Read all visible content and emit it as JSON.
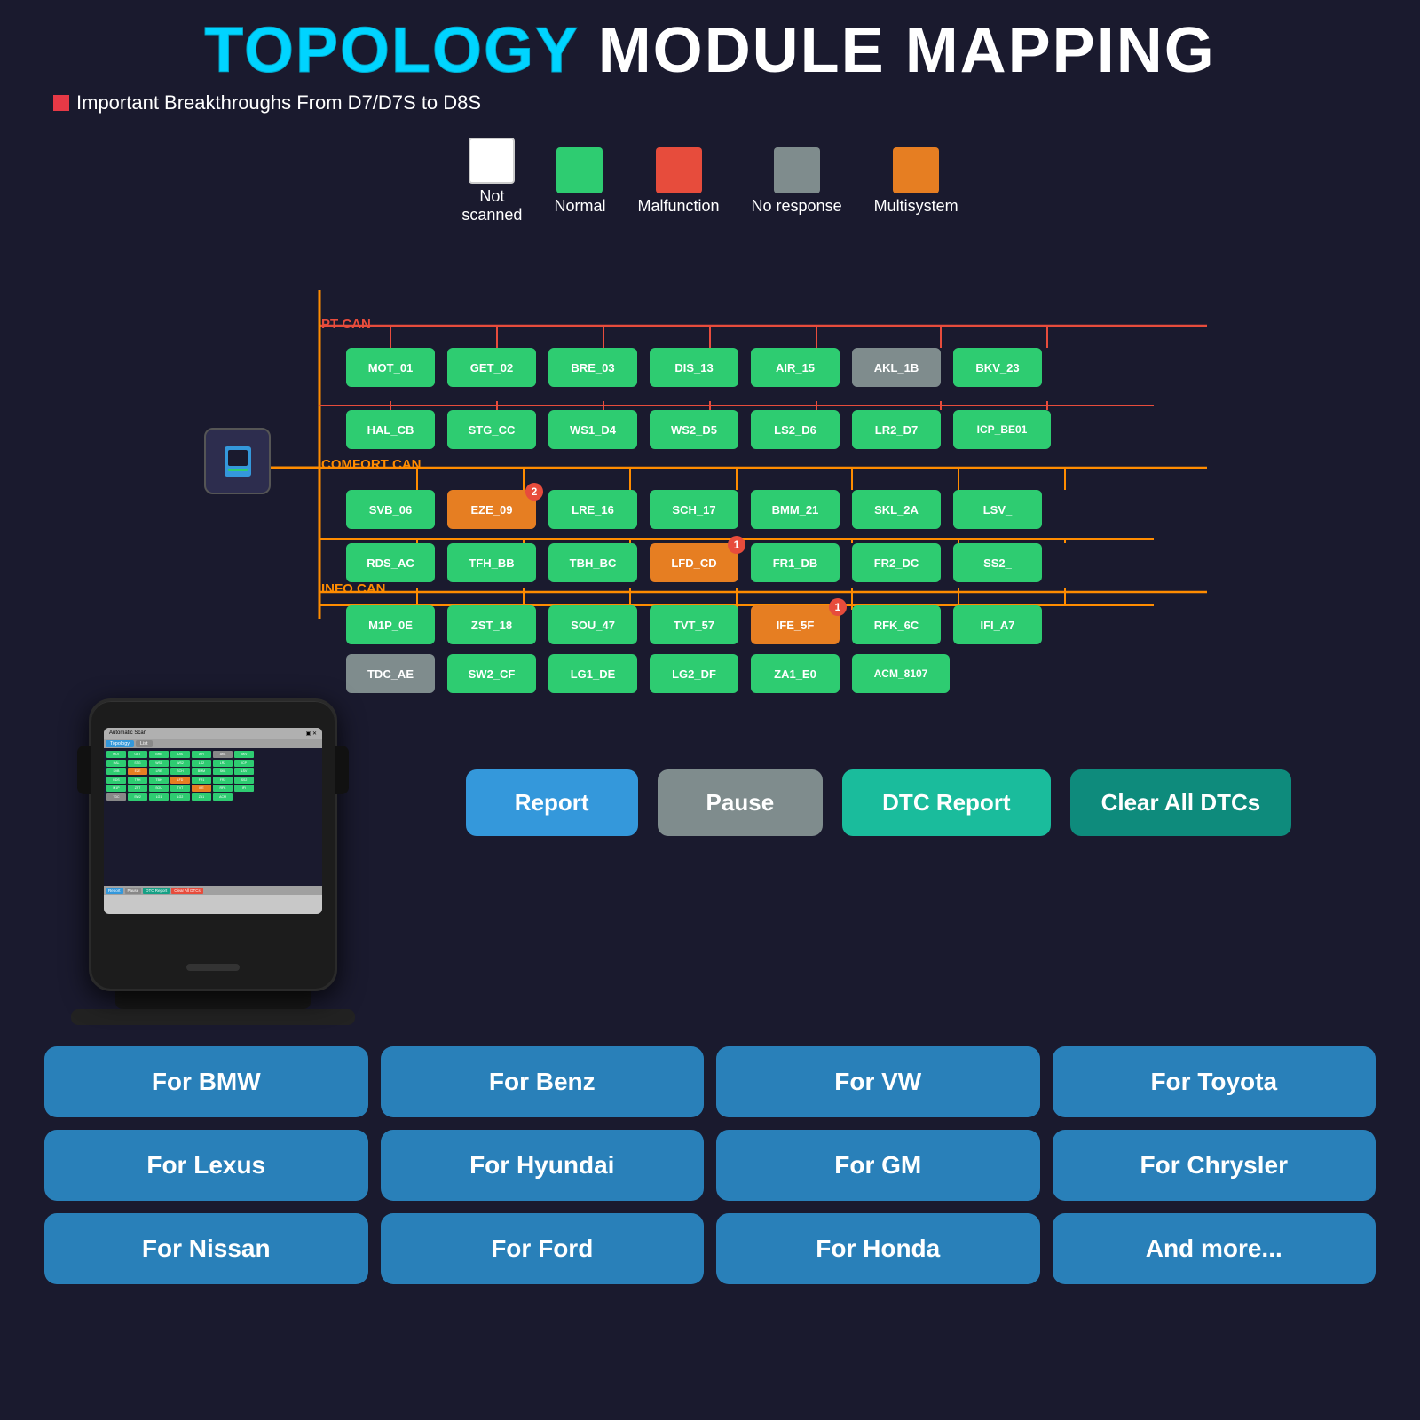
{
  "header": {
    "title_cyan": "TOPOLOGY",
    "title_white": " MODULE MAPPING",
    "subtitle": "Important Breakthroughs From D7/D7S to D8S"
  },
  "legend": [
    {
      "id": "not-scanned",
      "color": "#ffffff",
      "border": "#cccccc",
      "label": "Not\nscanned"
    },
    {
      "id": "normal",
      "color": "#2ecc71",
      "border": "none",
      "label": "Normal"
    },
    {
      "id": "malfunction",
      "color": "#e74c3c",
      "border": "none",
      "label": "Malfunction"
    },
    {
      "id": "no-response",
      "color": "#7f8c8d",
      "border": "none",
      "label": "No response"
    },
    {
      "id": "multisystem",
      "color": "#e67e22",
      "border": "none",
      "label": "Multisystem"
    }
  ],
  "topology": {
    "scan_device_icon": "📋",
    "buses": [
      {
        "id": "pt-can",
        "label": "PT CAN"
      },
      {
        "id": "comfort-can",
        "label": "COMFORT CAN"
      },
      {
        "id": "info-can",
        "label": "INFO CAN"
      }
    ],
    "nodes": [
      {
        "id": "MOT_01",
        "label": "MOT_01",
        "color": "green",
        "row": 0,
        "col": 0
      },
      {
        "id": "GET_02",
        "label": "GET_02",
        "color": "green",
        "row": 0,
        "col": 1
      },
      {
        "id": "BRE_03",
        "label": "BRE_03",
        "color": "green",
        "row": 0,
        "col": 2
      },
      {
        "id": "DIS_13",
        "label": "DIS_13",
        "color": "green",
        "row": 0,
        "col": 3
      },
      {
        "id": "AIR_15",
        "label": "AIR_15",
        "color": "green",
        "row": 0,
        "col": 4
      },
      {
        "id": "AKL_1B",
        "label": "AKL_1B",
        "color": "gray",
        "row": 0,
        "col": 5
      },
      {
        "id": "BKV_23",
        "label": "BKV_23",
        "color": "green",
        "row": 0,
        "col": 6
      },
      {
        "id": "HAL_CB",
        "label": "HAL_CB",
        "color": "green",
        "row": 1,
        "col": 0
      },
      {
        "id": "STG_CC",
        "label": "STG_CC",
        "color": "green",
        "row": 1,
        "col": 1
      },
      {
        "id": "WS1_D4",
        "label": "WS1_D4",
        "color": "green",
        "row": 1,
        "col": 2
      },
      {
        "id": "WS2_D5",
        "label": "WS2_D5",
        "color": "green",
        "row": 1,
        "col": 3
      },
      {
        "id": "LS2_D6",
        "label": "LS2_D6",
        "color": "green",
        "row": 1,
        "col": 4
      },
      {
        "id": "LR2_D7",
        "label": "LR2_D7",
        "color": "green",
        "row": 1,
        "col": 5
      },
      {
        "id": "ICP_BE01",
        "label": "ICP_BE01",
        "color": "green",
        "row": 1,
        "col": 6
      },
      {
        "id": "SVB_06",
        "label": "SVB_06",
        "color": "green",
        "row": 2,
        "col": 0
      },
      {
        "id": "EZE_09",
        "label": "EZE_09",
        "color": "orange",
        "row": 2,
        "col": 1,
        "badge": "2"
      },
      {
        "id": "LRE_16",
        "label": "LRE_16",
        "color": "green",
        "row": 2,
        "col": 2
      },
      {
        "id": "SCH_17",
        "label": "SCH_17",
        "color": "green",
        "row": 2,
        "col": 3
      },
      {
        "id": "BMM_21",
        "label": "BMM_21",
        "color": "green",
        "row": 2,
        "col": 4
      },
      {
        "id": "SKL_2A",
        "label": "SKL_2A",
        "color": "green",
        "row": 2,
        "col": 5
      },
      {
        "id": "LSV_",
        "label": "LSV_",
        "color": "green",
        "row": 2,
        "col": 6
      },
      {
        "id": "RDS_AC",
        "label": "RDS_AC",
        "color": "green",
        "row": 3,
        "col": 0
      },
      {
        "id": "TFH_BB",
        "label": "TFH_BB",
        "color": "green",
        "row": 3,
        "col": 1
      },
      {
        "id": "TBH_BC",
        "label": "TBH_BC",
        "color": "green",
        "row": 3,
        "col": 2
      },
      {
        "id": "LFD_CD",
        "label": "LFD_CD",
        "color": "orange",
        "row": 3,
        "col": 3,
        "badge": "1"
      },
      {
        "id": "FR1_DB",
        "label": "FR1_DB",
        "color": "green",
        "row": 3,
        "col": 4
      },
      {
        "id": "FR2_DC",
        "label": "FR2_DC",
        "color": "green",
        "row": 3,
        "col": 5
      },
      {
        "id": "SS2_",
        "label": "SS2_",
        "color": "green",
        "row": 3,
        "col": 6
      },
      {
        "id": "M1P_0E",
        "label": "M1P_0E",
        "color": "green",
        "row": 4,
        "col": 0
      },
      {
        "id": "ZST_18",
        "label": "ZST_18",
        "color": "green",
        "row": 4,
        "col": 1
      },
      {
        "id": "SOU_47",
        "label": "SOU_47",
        "color": "green",
        "row": 4,
        "col": 2
      },
      {
        "id": "TVT_57",
        "label": "TVT_57",
        "color": "green",
        "row": 4,
        "col": 3
      },
      {
        "id": "IFE_5F",
        "label": "IFE_5F",
        "color": "orange",
        "row": 4,
        "col": 4,
        "badge": "1"
      },
      {
        "id": "RFK_6C",
        "label": "RFK_6C",
        "color": "green",
        "row": 4,
        "col": 5
      },
      {
        "id": "IFI_A7",
        "label": "IFI_A7",
        "color": "green",
        "row": 4,
        "col": 6
      },
      {
        "id": "TDC_AE",
        "label": "TDC_AE",
        "color": "gray",
        "row": 5,
        "col": 0
      },
      {
        "id": "SW2_CF",
        "label": "SW2_CF",
        "color": "green",
        "row": 5,
        "col": 1
      },
      {
        "id": "LG1_DE",
        "label": "LG1_DE",
        "color": "green",
        "row": 5,
        "col": 2
      },
      {
        "id": "LG2_DF",
        "label": "LG2_DF",
        "color": "green",
        "row": 5,
        "col": 3
      },
      {
        "id": "ZA1_E0",
        "label": "ZA1_E0",
        "color": "green",
        "row": 5,
        "col": 4
      },
      {
        "id": "ACM_8107",
        "label": "ACM_8107",
        "color": "green",
        "row": 5,
        "col": 5
      }
    ]
  },
  "action_buttons": [
    {
      "id": "report-btn",
      "label": "Report",
      "color": "blue"
    },
    {
      "id": "pause-btn",
      "label": "Pause",
      "color": "gray"
    },
    {
      "id": "dtc-report-btn",
      "label": "DTC Report",
      "color": "teal"
    },
    {
      "id": "clear-dtc-btn",
      "label": "Clear All DTCs",
      "color": "teal"
    }
  ],
  "brand_buttons": [
    {
      "id": "bmw-btn",
      "label": "For BMW"
    },
    {
      "id": "benz-btn",
      "label": "For Benz"
    },
    {
      "id": "vw-btn",
      "label": "For VW"
    },
    {
      "id": "toyota-btn",
      "label": "For Toyota"
    },
    {
      "id": "lexus-btn",
      "label": "For Lexus"
    },
    {
      "id": "hyundai-btn",
      "label": "For Hyundai"
    },
    {
      "id": "gm-btn",
      "label": "For GM"
    },
    {
      "id": "chrysler-btn",
      "label": "For Chrysler"
    },
    {
      "id": "nissan-btn",
      "label": "For Nissan"
    },
    {
      "id": "ford-btn",
      "label": "For Ford"
    },
    {
      "id": "honda-btn",
      "label": "For Honda"
    },
    {
      "id": "more-btn",
      "label": "And more..."
    }
  ]
}
